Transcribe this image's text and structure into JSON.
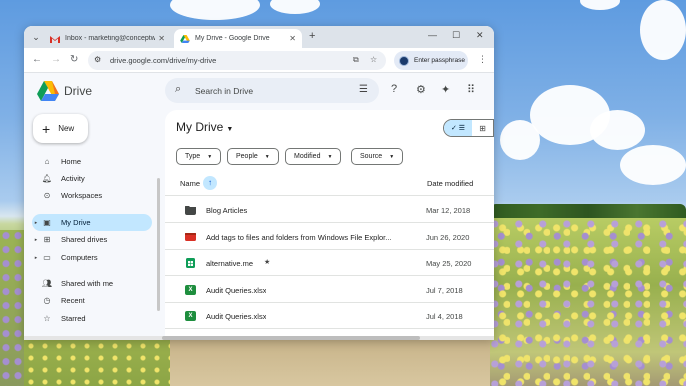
{
  "browser": {
    "tabs": [
      {
        "title": "Inbox - marketing@conceptwo",
        "favicon": "gmail-icon",
        "active": false
      },
      {
        "title": "My Drive - Google Drive",
        "favicon": "google-drive-icon",
        "active": true
      }
    ],
    "new_tab_label": "+",
    "url": "drive.google.com/drive/my-drive",
    "passphrase_label": "Enter passphrase"
  },
  "drive": {
    "brand": "Drive",
    "search_placeholder": "Search in Drive",
    "new_label": "New",
    "nav": [
      {
        "label": "Home",
        "icon": "home-icon",
        "selected": false
      },
      {
        "label": "Activity",
        "icon": "bell-icon",
        "selected": false
      },
      {
        "label": "Workspaces",
        "icon": "workspaces-icon",
        "selected": false
      },
      {
        "label": "My Drive",
        "icon": "my-drive-icon",
        "selected": true
      },
      {
        "label": "Shared drives",
        "icon": "shared-drives-icon",
        "selected": false
      },
      {
        "label": "Computers",
        "icon": "computer-icon",
        "selected": false
      },
      {
        "label": "Shared with me",
        "icon": "people-icon",
        "selected": false
      },
      {
        "label": "Recent",
        "icon": "clock-icon",
        "selected": false
      },
      {
        "label": "Starred",
        "icon": "star-icon",
        "selected": false
      }
    ],
    "page_title": "My Drive",
    "filters": [
      "Type",
      "People",
      "Modified",
      "Source"
    ],
    "columns": {
      "name": "Name",
      "date": "Date modified"
    },
    "files": [
      {
        "name": "Blog Articles",
        "type": "folder",
        "date": "Mar 12, 2018",
        "starred": false
      },
      {
        "name": "Add tags to files and folders from Windows File Explor...",
        "type": "video",
        "date": "Jun 26, 2020",
        "starred": false
      },
      {
        "name": "alternative.me",
        "type": "sheets",
        "date": "May 25, 2020",
        "starred": true
      },
      {
        "name": "Audit Queries.xlsx",
        "type": "excel",
        "date": "Jul 7, 2018",
        "starred": false
      },
      {
        "name": "Audit Queries.xlsx",
        "type": "excel",
        "date": "Jul 4, 2018",
        "starred": false
      }
    ]
  }
}
